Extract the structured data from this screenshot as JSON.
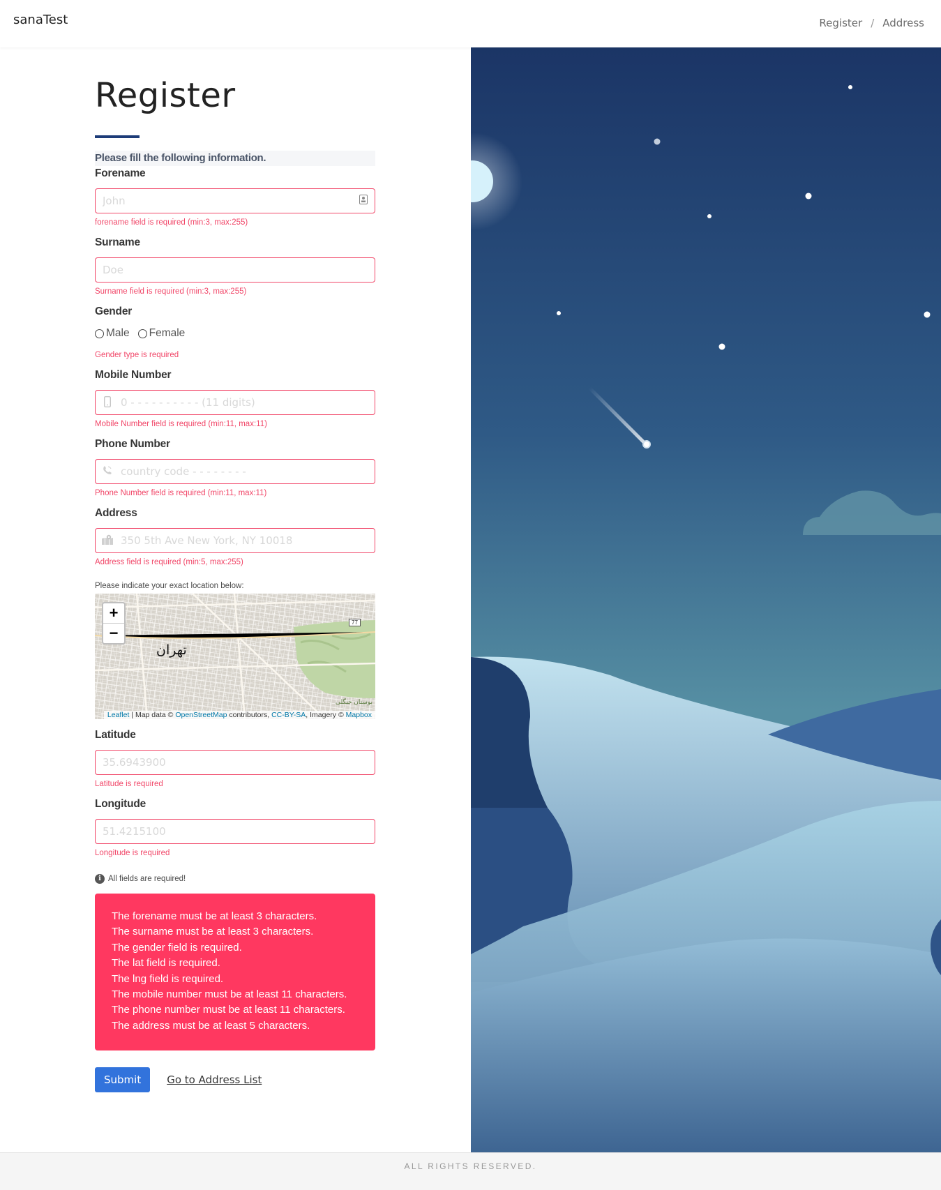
{
  "app": {
    "brand": "sanaTest"
  },
  "breadcrumb": {
    "register": "Register",
    "separator": "/",
    "address": "Address"
  },
  "form": {
    "title": "Register",
    "subtitle": "Please fill the following information.",
    "forename": {
      "label": "Forename",
      "placeholder": "John",
      "error": "forename field is required (min:3, max:255)"
    },
    "surname": {
      "label": "Surname",
      "placeholder": "Doe",
      "error": "Surname field is required (min:3, max:255)"
    },
    "gender": {
      "label": "Gender",
      "options": [
        "Male",
        "Female"
      ],
      "error": "Gender type is required"
    },
    "mobile": {
      "label": "Mobile Number",
      "placeholder": "0 - - - - - - - - - - (11 digits)",
      "error": "Mobile Number field is required (min:11, max:11)"
    },
    "phone": {
      "label": "Phone Number",
      "placeholder": "country code - - - - - - - -",
      "error": "Phone Number field is required (min:11, max:11)"
    },
    "address": {
      "label": "Address",
      "placeholder": "350 5th Ave New York, NY 10018",
      "error": "Address field is required (min:5, max:255)"
    },
    "map": {
      "note": "Please indicate your exact location below:",
      "zoom_in": "+",
      "zoom_out": "−",
      "city_label": "تهران",
      "road_shield": "77",
      "park_label": "بوستان جنگلی",
      "attribution": {
        "leaflet": "Leaflet",
        "sep": " | Map data © ",
        "osm": "OpenStreetMap",
        "contrib": " contributors, ",
        "license": "CC-BY-SA",
        "imagery": ", Imagery © ",
        "mapbox": "Mapbox"
      }
    },
    "latitude": {
      "label": "Latitude",
      "placeholder": "35.6943900",
      "error": "Latitude is required"
    },
    "longitude": {
      "label": "Longitude",
      "placeholder": "51.4215100",
      "error": "Longitude is required"
    },
    "required_note": "All fields are required!",
    "errors": [
      "The forename must be at least 3 characters.",
      "The surname must be at least 3 characters.",
      "The gender field is required.",
      "The lat field is required.",
      "The lng field is required.",
      "The mobile number must be at least 11 characters.",
      "The phone number must be at least 11 characters.",
      "The address must be at least 5 characters."
    ],
    "submit_label": "Submit",
    "address_list_link": "Go to Address List"
  },
  "footer": {
    "text": "ALL RIGHTS RESERVED."
  },
  "colors": {
    "error": "#f14668",
    "error_box": "#ff3860",
    "primary": "#3273dc",
    "accent_bar": "#1d3c78",
    "sky_top": "#1b3566",
    "sky_bottom": "#568fa3"
  }
}
